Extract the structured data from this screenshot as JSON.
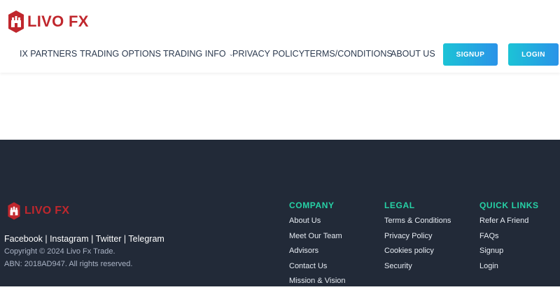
{
  "brand": {
    "name": "LIVO FX",
    "primary_color": "#c0272d",
    "accent_gradient": [
      "#1cc3d6",
      "#2a93e8"
    ],
    "footer_bg": "#222a38",
    "heading_color": "#26d2a6"
  },
  "header": {
    "nav": [
      {
        "label": "IX PARTNERS",
        "dropdown": false
      },
      {
        "label": "TRADING OPTIONS",
        "dropdown": true
      },
      {
        "label": "TRADING INFO",
        "dropdown": true
      },
      {
        "label": "PRIVACY POLICY",
        "dropdown": false
      },
      {
        "label": "TERMS/CONDITIONS",
        "dropdown": false
      },
      {
        "label": "ABOUT US",
        "dropdown": false
      }
    ],
    "signup_label": "SIGNUP",
    "login_label": "LOGIN",
    "caret_icon": "chevron-down-icon"
  },
  "footer": {
    "brand_name": "LIVO FX",
    "social_line": "Facebook | Instagram | Twitter | Telegram",
    "copyright": "Copyright © 2024 Livo Fx Trade.",
    "abn": "ABN: 2018AD947. All rights reserved.",
    "columns": [
      {
        "heading": "COMPANY",
        "links": [
          "About Us",
          "Meet Our Team",
          "Advisors",
          "Contact Us",
          "Mission & Vision"
        ]
      },
      {
        "heading": "LEGAL",
        "links": [
          "Terms & Conditions",
          "Privacy Policy",
          "Cookies policy",
          "Security"
        ]
      },
      {
        "heading": "QUICK LINKS",
        "links": [
          "Refer A Friend",
          "FAQs",
          "Signup",
          "Login"
        ]
      }
    ]
  }
}
